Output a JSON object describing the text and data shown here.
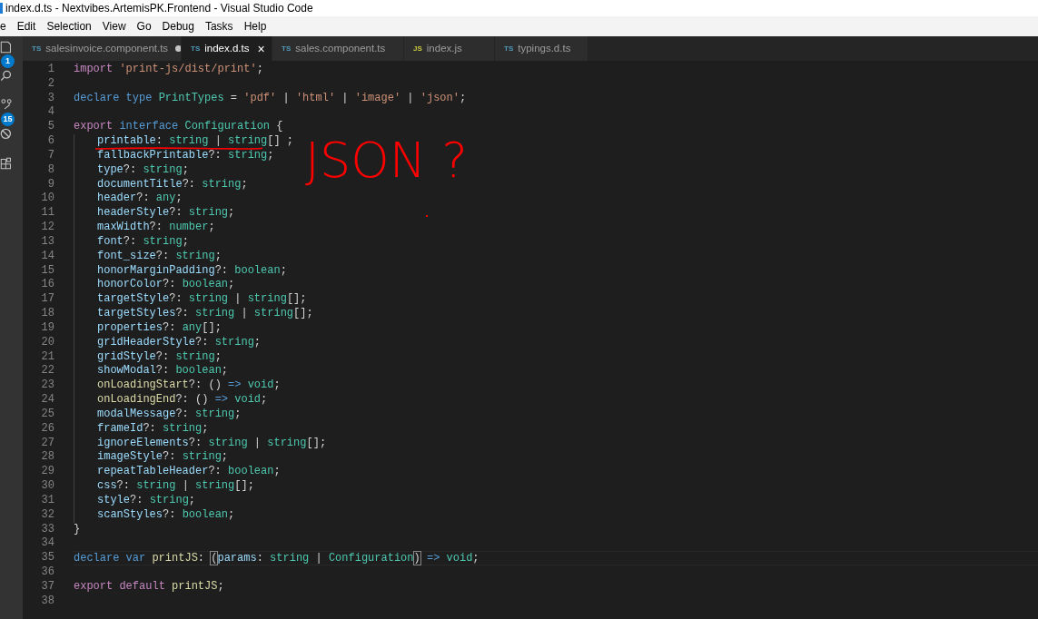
{
  "window": {
    "title": "index.d.ts - Nextvibes.ArtemisPK.Frontend - Visual Studio Code"
  },
  "menu": [
    "e",
    "Edit",
    "Selection",
    "View",
    "Go",
    "Debug",
    "Tasks",
    "Help"
  ],
  "activity_bar": [
    {
      "kind": "explorer",
      "badge": "1"
    },
    {
      "kind": "search"
    },
    {
      "kind": "source-control",
      "badge": "15"
    },
    {
      "kind": "debug"
    },
    {
      "kind": "extensions"
    }
  ],
  "tabs": [
    {
      "lang": "TS",
      "label": "salesinvoice.component.ts",
      "selected": false,
      "modified": true
    },
    {
      "lang": "TS",
      "label": "index.d.ts",
      "selected": true,
      "modified": false
    },
    {
      "lang": "TS",
      "label": "sales.component.ts",
      "selected": false,
      "modified": false
    },
    {
      "lang": "JS",
      "label": "index.js",
      "selected": false,
      "modified": false
    },
    {
      "lang": "TS",
      "label": "typings.d.ts",
      "selected": false,
      "modified": false
    }
  ],
  "close_glyph": "×",
  "editor": {
    "lines": [
      {
        "n": "1",
        "tokens": [
          {
            "kind": "control",
            "text": "import "
          },
          {
            "kind": "string",
            "text": "'print-js/dist/print'"
          },
          {
            "kind": "plain",
            "text": ";"
          }
        ]
      },
      {
        "n": "2"
      },
      {
        "n": "3",
        "tokens": [
          {
            "kind": "keyword",
            "text": "declare "
          },
          {
            "kind": "keyword",
            "text": "type "
          },
          {
            "kind": "type",
            "text": "PrintTypes"
          },
          {
            "kind": "plain",
            "text": " = "
          },
          {
            "kind": "string",
            "text": "'pdf'"
          },
          {
            "kind": "plain",
            "text": " | "
          },
          {
            "kind": "string",
            "text": "'html'"
          },
          {
            "kind": "plain",
            "text": " | "
          },
          {
            "kind": "string",
            "text": "'image'"
          },
          {
            "kind": "plain",
            "text": " | "
          },
          {
            "kind": "string",
            "text": "'json'"
          },
          {
            "kind": "plain",
            "text": ";"
          }
        ]
      },
      {
        "n": "4"
      },
      {
        "n": "5",
        "tokens": [
          {
            "kind": "control",
            "text": "export "
          },
          {
            "kind": "keyword",
            "text": "interface "
          },
          {
            "kind": "type",
            "text": "Configuration"
          },
          {
            "kind": "plain",
            "text": " {"
          }
        ]
      },
      {
        "n": "6",
        "indented": true,
        "tokens": [
          {
            "kind": "property",
            "text": "printable"
          },
          {
            "kind": "plain",
            "text": ": "
          },
          {
            "kind": "type",
            "text": "string"
          },
          {
            "kind": "plain",
            "text": " | "
          },
          {
            "kind": "type",
            "text": "string"
          },
          {
            "kind": "plain",
            "text": "[] ;"
          }
        ]
      },
      {
        "n": "7",
        "indented": true,
        "tokens": [
          {
            "kind": "property",
            "text": "fallbackPrintable"
          },
          {
            "kind": "plain",
            "text": "?: "
          },
          {
            "kind": "type",
            "text": "string"
          },
          {
            "kind": "plain",
            "text": ";"
          }
        ]
      },
      {
        "n": "8",
        "indented": true,
        "tokens": [
          {
            "kind": "property",
            "text": "type"
          },
          {
            "kind": "plain",
            "text": "?: "
          },
          {
            "kind": "type",
            "text": "string"
          },
          {
            "kind": "plain",
            "text": ";"
          }
        ]
      },
      {
        "n": "9",
        "indented": true,
        "tokens": [
          {
            "kind": "property",
            "text": "documentTitle"
          },
          {
            "kind": "plain",
            "text": "?: "
          },
          {
            "kind": "type",
            "text": "string"
          },
          {
            "kind": "plain",
            "text": ";"
          }
        ]
      },
      {
        "n": "10",
        "indented": true,
        "tokens": [
          {
            "kind": "property",
            "text": "header"
          },
          {
            "kind": "plain",
            "text": "?: "
          },
          {
            "kind": "type",
            "text": "any"
          },
          {
            "kind": "plain",
            "text": ";"
          }
        ]
      },
      {
        "n": "11",
        "indented": true,
        "tokens": [
          {
            "kind": "property",
            "text": "headerStyle"
          },
          {
            "kind": "plain",
            "text": "?: "
          },
          {
            "kind": "type",
            "text": "string"
          },
          {
            "kind": "plain",
            "text": ";"
          }
        ]
      },
      {
        "n": "12",
        "indented": true,
        "tokens": [
          {
            "kind": "property",
            "text": "maxWidth"
          },
          {
            "kind": "plain",
            "text": "?: "
          },
          {
            "kind": "type",
            "text": "number"
          },
          {
            "kind": "plain",
            "text": ";"
          }
        ]
      },
      {
        "n": "13",
        "indented": true,
        "tokens": [
          {
            "kind": "property",
            "text": "font"
          },
          {
            "kind": "plain",
            "text": "?: "
          },
          {
            "kind": "type",
            "text": "string"
          },
          {
            "kind": "plain",
            "text": ";"
          }
        ]
      },
      {
        "n": "14",
        "indented": true,
        "tokens": [
          {
            "kind": "property",
            "text": "font_size"
          },
          {
            "kind": "plain",
            "text": "?: "
          },
          {
            "kind": "type",
            "text": "string"
          },
          {
            "kind": "plain",
            "text": ";"
          }
        ]
      },
      {
        "n": "15",
        "indented": true,
        "tokens": [
          {
            "kind": "property",
            "text": "honorMarginPadding"
          },
          {
            "kind": "plain",
            "text": "?: "
          },
          {
            "kind": "type",
            "text": "boolean"
          },
          {
            "kind": "plain",
            "text": ";"
          }
        ]
      },
      {
        "n": "16",
        "indented": true,
        "tokens": [
          {
            "kind": "property",
            "text": "honorColor"
          },
          {
            "kind": "plain",
            "text": "?: "
          },
          {
            "kind": "type",
            "text": "boolean"
          },
          {
            "kind": "plain",
            "text": ";"
          }
        ]
      },
      {
        "n": "17",
        "indented": true,
        "tokens": [
          {
            "kind": "property",
            "text": "targetStyle"
          },
          {
            "kind": "plain",
            "text": "?: "
          },
          {
            "kind": "type",
            "text": "string"
          },
          {
            "kind": "plain",
            "text": " | "
          },
          {
            "kind": "type",
            "text": "string"
          },
          {
            "kind": "plain",
            "text": "[];"
          }
        ]
      },
      {
        "n": "18",
        "indented": true,
        "tokens": [
          {
            "kind": "property",
            "text": "targetStyles"
          },
          {
            "kind": "plain",
            "text": "?: "
          },
          {
            "kind": "type",
            "text": "string"
          },
          {
            "kind": "plain",
            "text": " | "
          },
          {
            "kind": "type",
            "text": "string"
          },
          {
            "kind": "plain",
            "text": "[];"
          }
        ]
      },
      {
        "n": "19",
        "indented": true,
        "tokens": [
          {
            "kind": "property",
            "text": "properties"
          },
          {
            "kind": "plain",
            "text": "?: "
          },
          {
            "kind": "type",
            "text": "any"
          },
          {
            "kind": "plain",
            "text": "[];"
          }
        ]
      },
      {
        "n": "20",
        "indented": true,
        "tokens": [
          {
            "kind": "property",
            "text": "gridHeaderStyle"
          },
          {
            "kind": "plain",
            "text": "?: "
          },
          {
            "kind": "type",
            "text": "string"
          },
          {
            "kind": "plain",
            "text": ";"
          }
        ]
      },
      {
        "n": "21",
        "indented": true,
        "tokens": [
          {
            "kind": "property",
            "text": "gridStyle"
          },
          {
            "kind": "plain",
            "text": "?: "
          },
          {
            "kind": "type",
            "text": "string"
          },
          {
            "kind": "plain",
            "text": ";"
          }
        ]
      },
      {
        "n": "22",
        "indented": true,
        "tokens": [
          {
            "kind": "property",
            "text": "showModal"
          },
          {
            "kind": "plain",
            "text": "?: "
          },
          {
            "kind": "type",
            "text": "boolean"
          },
          {
            "kind": "plain",
            "text": ";"
          }
        ]
      },
      {
        "n": "23",
        "indented": true,
        "tokens": [
          {
            "kind": "function",
            "text": "onLoadingStart"
          },
          {
            "kind": "plain",
            "text": "?: () "
          },
          {
            "kind": "keyword",
            "text": "=> "
          },
          {
            "kind": "type",
            "text": "void"
          },
          {
            "kind": "plain",
            "text": ";"
          }
        ]
      },
      {
        "n": "24",
        "indented": true,
        "tokens": [
          {
            "kind": "function",
            "text": "onLoadingEnd"
          },
          {
            "kind": "plain",
            "text": "?: () "
          },
          {
            "kind": "keyword",
            "text": "=> "
          },
          {
            "kind": "type",
            "text": "void"
          },
          {
            "kind": "plain",
            "text": ";"
          }
        ]
      },
      {
        "n": "25",
        "indented": true,
        "tokens": [
          {
            "kind": "property",
            "text": "modalMessage"
          },
          {
            "kind": "plain",
            "text": "?: "
          },
          {
            "kind": "type",
            "text": "string"
          },
          {
            "kind": "plain",
            "text": ";"
          }
        ]
      },
      {
        "n": "26",
        "indented": true,
        "tokens": [
          {
            "kind": "property",
            "text": "frameId"
          },
          {
            "kind": "plain",
            "text": "?: "
          },
          {
            "kind": "type",
            "text": "string"
          },
          {
            "kind": "plain",
            "text": ";"
          }
        ]
      },
      {
        "n": "27",
        "indented": true,
        "tokens": [
          {
            "kind": "property",
            "text": "ignoreElements"
          },
          {
            "kind": "plain",
            "text": "?: "
          },
          {
            "kind": "type",
            "text": "string"
          },
          {
            "kind": "plain",
            "text": " | "
          },
          {
            "kind": "type",
            "text": "string"
          },
          {
            "kind": "plain",
            "text": "[];"
          }
        ]
      },
      {
        "n": "28",
        "indented": true,
        "tokens": [
          {
            "kind": "property",
            "text": "imageStyle"
          },
          {
            "kind": "plain",
            "text": "?: "
          },
          {
            "kind": "type",
            "text": "string"
          },
          {
            "kind": "plain",
            "text": ";"
          }
        ]
      },
      {
        "n": "29",
        "indented": true,
        "tokens": [
          {
            "kind": "property",
            "text": "repeatTableHeader"
          },
          {
            "kind": "plain",
            "text": "?: "
          },
          {
            "kind": "type",
            "text": "boolean"
          },
          {
            "kind": "plain",
            "text": ";"
          }
        ]
      },
      {
        "n": "30",
        "indented": true,
        "tokens": [
          {
            "kind": "property",
            "text": "css"
          },
          {
            "kind": "plain",
            "text": "?: "
          },
          {
            "kind": "type",
            "text": "string"
          },
          {
            "kind": "plain",
            "text": " | "
          },
          {
            "kind": "type",
            "text": "string"
          },
          {
            "kind": "plain",
            "text": "[];"
          }
        ]
      },
      {
        "n": "31",
        "indented": true,
        "tokens": [
          {
            "kind": "property",
            "text": "style"
          },
          {
            "kind": "plain",
            "text": "?: "
          },
          {
            "kind": "type",
            "text": "string"
          },
          {
            "kind": "plain",
            "text": ";"
          }
        ]
      },
      {
        "n": "32",
        "indented": true,
        "tokens": [
          {
            "kind": "property",
            "text": "scanStyles"
          },
          {
            "kind": "plain",
            "text": "?: "
          },
          {
            "kind": "type",
            "text": "boolean"
          },
          {
            "kind": "plain",
            "text": ";"
          }
        ]
      },
      {
        "n": "33",
        "tokens": [
          {
            "kind": "plain",
            "text": "}"
          }
        ]
      },
      {
        "n": "34"
      },
      {
        "n": "35",
        "current": true,
        "tokens": [
          {
            "kind": "keyword",
            "text": "declare "
          },
          {
            "kind": "keyword",
            "text": "var "
          },
          {
            "kind": "function",
            "text": "printJS"
          },
          {
            "kind": "plain",
            "text": ": "
          },
          {
            "kind": "match",
            "text": "("
          },
          {
            "kind": "property",
            "text": "params"
          },
          {
            "kind": "plain",
            "text": ": "
          },
          {
            "kind": "type",
            "text": "string"
          },
          {
            "kind": "plain",
            "text": " | "
          },
          {
            "kind": "type",
            "text": "Configuration"
          },
          {
            "kind": "match",
            "text": ")"
          },
          {
            "kind": "keyword",
            "text": " => "
          },
          {
            "kind": "type",
            "text": "void"
          },
          {
            "kind": "plain",
            "text": ";"
          }
        ]
      },
      {
        "n": "36"
      },
      {
        "n": "37",
        "tokens": [
          {
            "kind": "control",
            "text": "export "
          },
          {
            "kind": "control",
            "text": "default "
          },
          {
            "kind": "function",
            "text": "printJS"
          },
          {
            "kind": "plain",
            "text": ";"
          }
        ]
      },
      {
        "n": "38"
      }
    ]
  },
  "annotation": {
    "text": "JSON ?",
    "color": "#ff0000"
  }
}
